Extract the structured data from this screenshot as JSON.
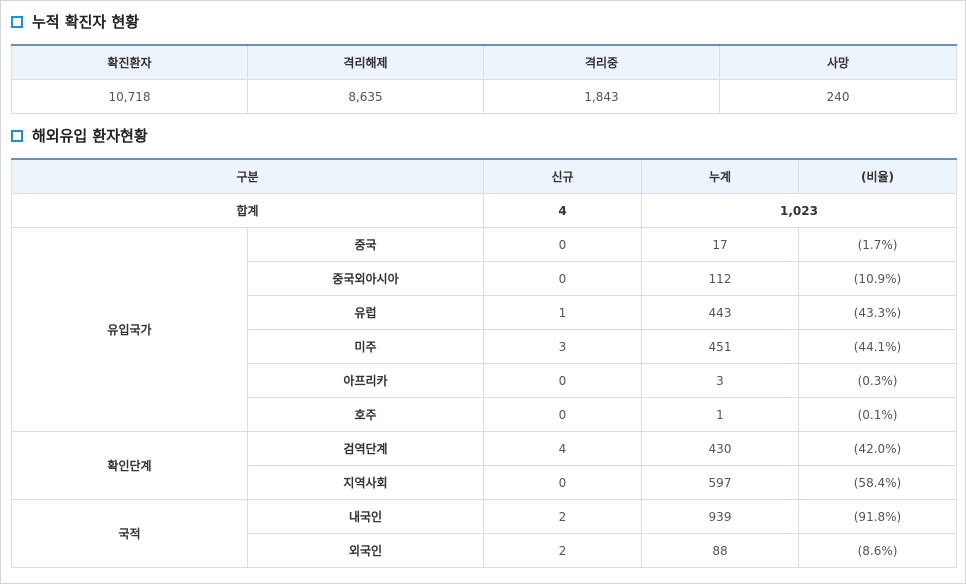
{
  "cumulative": {
    "title": "누적 확진자 현황",
    "headers": [
      "확진환자",
      "격리해제",
      "격리중",
      "사망"
    ],
    "values": [
      "10,718",
      "8,635",
      "1,843",
      "240"
    ]
  },
  "overseas": {
    "title": "해외유입 환자현황",
    "headers": {
      "category": "구분",
      "new": "신규",
      "total": "누계",
      "ratio": "(비율)"
    },
    "sum_row": {
      "label": "합계",
      "new": "4",
      "total": "1,023"
    },
    "groups": [
      {
        "label": "유입국가",
        "rows": [
          {
            "name": "중국",
            "new": "0",
            "total": "17",
            "ratio": "(1.7%)"
          },
          {
            "name": "중국외아시아",
            "new": "0",
            "total": "112",
            "ratio": "(10.9%)"
          },
          {
            "name": "유럽",
            "new": "1",
            "total": "443",
            "ratio": "(43.3%)"
          },
          {
            "name": "미주",
            "new": "3",
            "total": "451",
            "ratio": "(44.1%)"
          },
          {
            "name": "아프리카",
            "new": "0",
            "total": "3",
            "ratio": "(0.3%)"
          },
          {
            "name": "호주",
            "new": "0",
            "total": "1",
            "ratio": "(0.1%)"
          }
        ]
      },
      {
        "label": "확인단계",
        "rows": [
          {
            "name": "검역단계",
            "new": "4",
            "total": "430",
            "ratio": "(42.0%)"
          },
          {
            "name": "지역사회",
            "new": "0",
            "total": "597",
            "ratio": "(58.4%)"
          }
        ]
      },
      {
        "label": "국적",
        "rows": [
          {
            "name": "내국인",
            "new": "2",
            "total": "939",
            "ratio": "(91.8%)"
          },
          {
            "name": "외국인",
            "new": "2",
            "total": "88",
            "ratio": "(8.6%)"
          }
        ]
      }
    ]
  },
  "colors": {
    "accent": "#1e8fd0",
    "header_bg": "#eef4fb",
    "header_border": "#6b8fb8",
    "grid": "#d9dee6"
  },
  "icons": {
    "section_bullet": "square-bullet-icon"
  }
}
